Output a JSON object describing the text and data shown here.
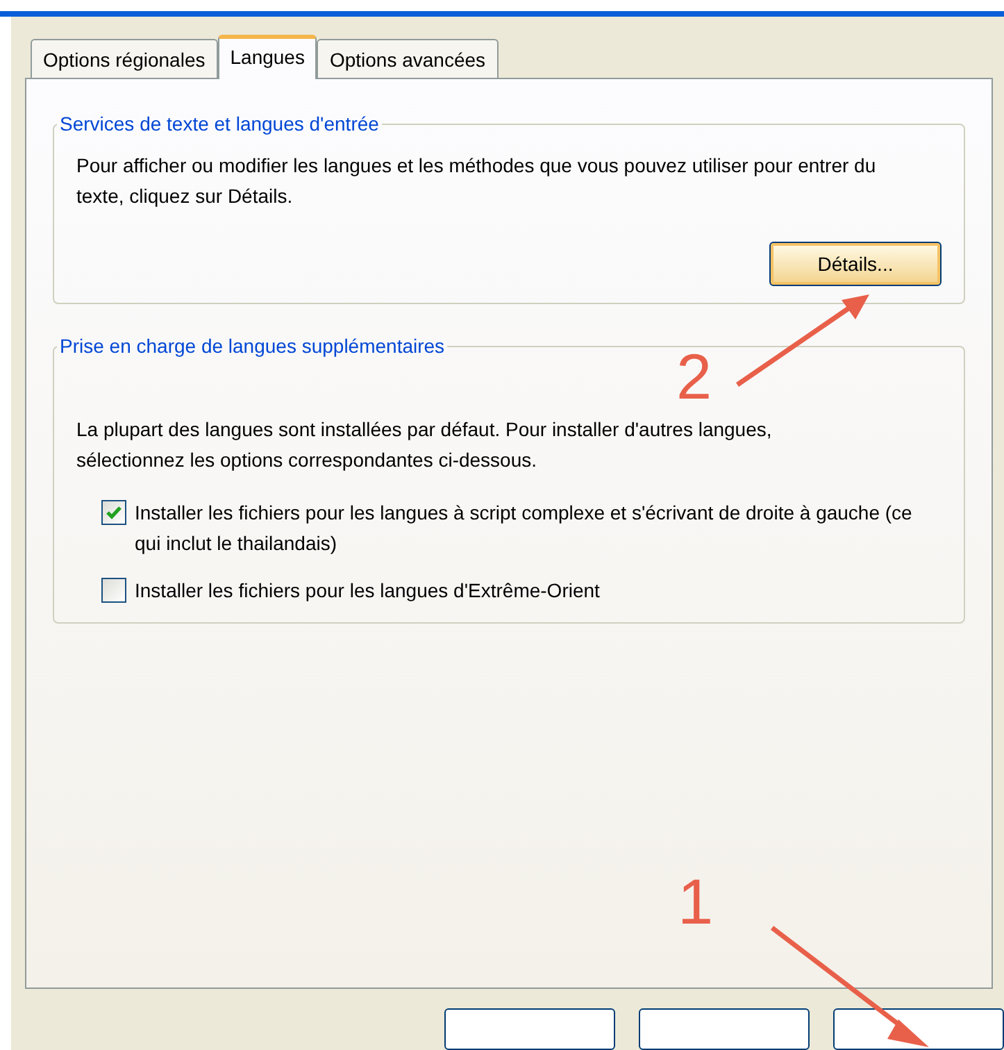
{
  "tabs": [
    {
      "label": "Options régionales",
      "selected": false
    },
    {
      "label": "Langues",
      "selected": true
    },
    {
      "label": "Options avancées",
      "selected": false
    }
  ],
  "groups": [
    {
      "title": "Services de texte et langues d'entrée",
      "description": "Pour afficher ou modifier les langues et les méthodes que vous pouvez utiliser pour entrer du texte, cliquez sur Détails.",
      "button": "Détails..."
    },
    {
      "title": "Prise en charge de langues supplémentaires",
      "description": "La plupart des langues sont installées par défaut. Pour installer d'autres langues, sélectionnez les options correspondantes ci-dessous.",
      "options": [
        {
          "label": "Installer les fichiers pour les langues à script complexe et s'écrivant de droite à gauche (ce qui inclut le thailandais)",
          "checked": true
        },
        {
          "label": "Installer les fichiers pour les langues d'Extrême-Orient",
          "checked": false
        }
      ]
    }
  ],
  "annotations": [
    {
      "number": "2"
    },
    {
      "number": "1"
    }
  ]
}
